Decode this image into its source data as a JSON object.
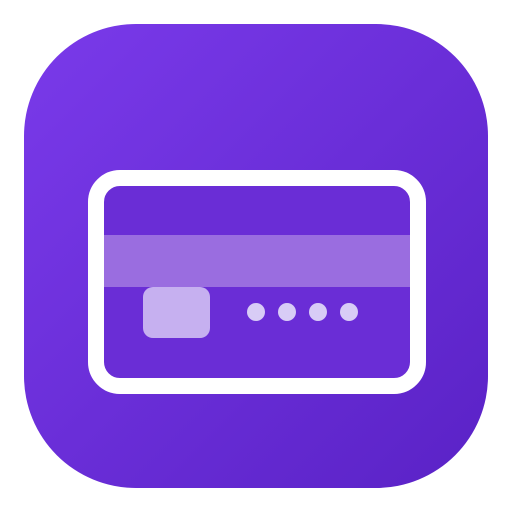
{
  "icon": {
    "name": "credit-card-app-icon",
    "background_gradient": [
      "#7A3AEA",
      "#5A22C6"
    ],
    "card_outline_color": "#FFFFFF",
    "card_fill_color": "#6A2DD6",
    "stripe_color": "#9A6DE0",
    "chip_color": "#C6B0F0",
    "dots_color": "#D8CCF6",
    "masked_digit_count": 4
  }
}
